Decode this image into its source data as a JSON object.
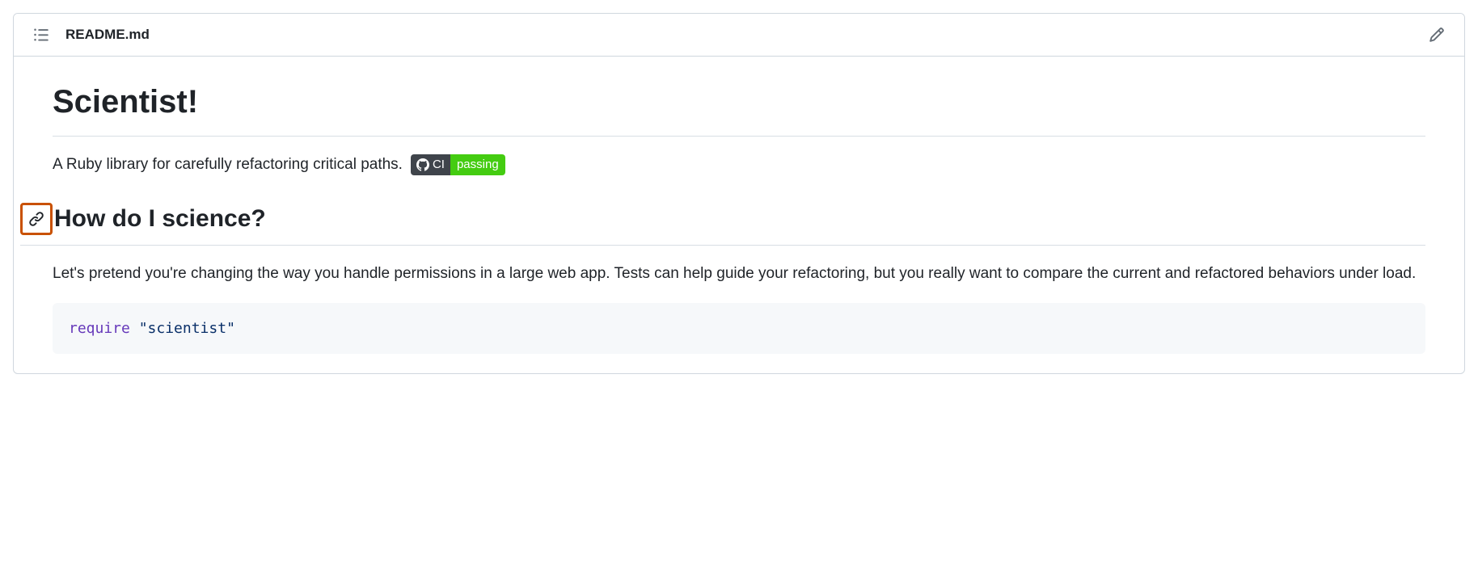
{
  "header": {
    "filename": "README.md"
  },
  "content": {
    "h1": "Scientist!",
    "description": "A Ruby library for carefully refactoring critical paths.",
    "badge": {
      "left": "CI",
      "right": "passing"
    },
    "h2": "How do I science?",
    "para": "Let's pretend you're changing the way you handle permissions in a large web app. Tests can help guide your refactoring, but you really want to compare the current and refactored behaviors under load.",
    "code": {
      "keyword": "require",
      "string": "\"scientist\""
    }
  }
}
